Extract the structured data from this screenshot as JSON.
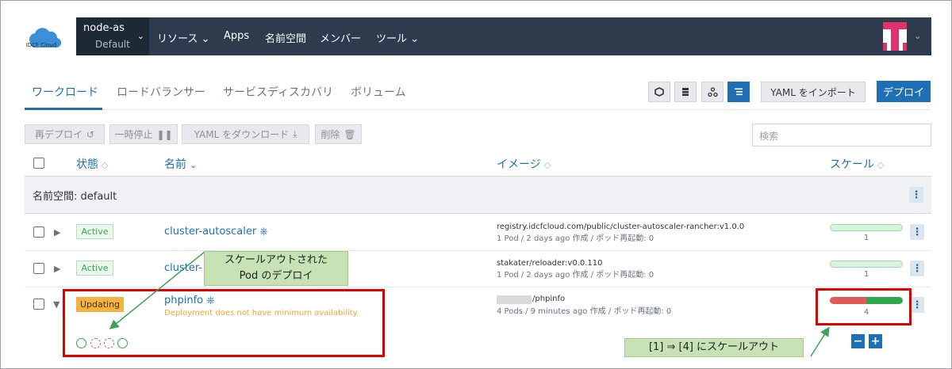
{
  "header": {
    "logo_text": "IDCF Cloud",
    "cluster_name": "node-as",
    "project_name": "Default",
    "menu": [
      "リソース",
      "Apps",
      "名前空間",
      "メンバー",
      "ツール"
    ]
  },
  "tabs": [
    "ワークロード",
    "ロードバランサー",
    "サービスディスカバリ",
    "ボリューム"
  ],
  "toolbar": {
    "import_label": "YAML をインポート",
    "deploy_label": "デプロイ"
  },
  "bulk_actions": {
    "redeploy": "再デプロイ",
    "pause": "一時停止",
    "download_yaml": "YAML をダウンロード",
    "delete": "削除"
  },
  "search_placeholder": "検索",
  "columns": {
    "state": "状態",
    "name": "名前",
    "image": "イメージ",
    "scale": "スケール"
  },
  "namespace_group": "名前空間: default",
  "rows": [
    {
      "state": "Active",
      "name": "cluster-autoscaler",
      "image": "registry.idcfcloud.com/public/cluster-autoscaler-rancher:v1.0.0",
      "meta": "1 Pod / 2 days ago 作成 / ポッド再起動: 0",
      "scale": "1"
    },
    {
      "state": "Active",
      "name": "cluster-",
      "image": "stakater/reloader:v0.0.110",
      "meta": "1 Pod / 2 days ago 作成 / ポッド再起動: 0",
      "scale": "1"
    },
    {
      "state": "Updating",
      "name": "phpinfo",
      "warning": "Deployment does not have minimum availability.",
      "image": "/phpinfo",
      "meta": "4 Pods / 9 minutes ago 作成 / ポッド再起動: 0",
      "scale": "4"
    }
  ],
  "annotations": {
    "pod_deploy_line1": "スケールアウトされた",
    "pod_deploy_line2": "Pod のデプロイ",
    "scale_out": "[1] ⇒ [4] にスケールアウト"
  },
  "colors": {
    "accent": "#1f6fb5",
    "topbar": "#2e3b4d",
    "active": "#3aa356",
    "updating": "#f3b43f",
    "highlight": "#e00000",
    "callout": "#c7e2b4"
  }
}
